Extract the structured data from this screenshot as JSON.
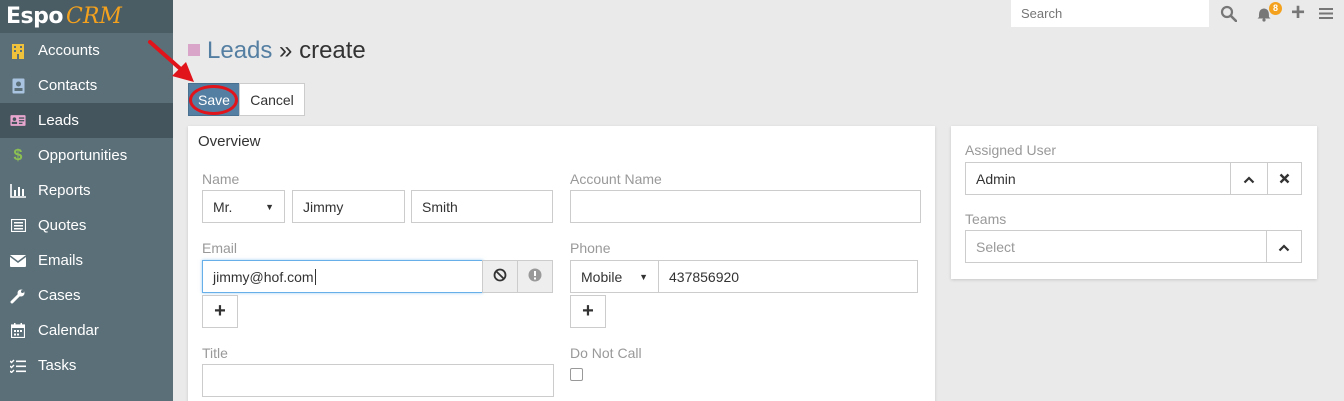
{
  "logo": {
    "espo": "Espo",
    "crm": "CRM"
  },
  "sidebar": {
    "items": [
      {
        "label": "Accounts",
        "icon": "building-icon"
      },
      {
        "label": "Contacts",
        "icon": "contact-card-icon"
      },
      {
        "label": "Leads",
        "icon": "id-card-icon"
      },
      {
        "label": "Opportunities",
        "icon": "dollar-icon"
      },
      {
        "label": "Reports",
        "icon": "bar-chart-icon"
      },
      {
        "label": "Quotes",
        "icon": "list-icon"
      },
      {
        "label": "Emails",
        "icon": "envelope-icon"
      },
      {
        "label": "Cases",
        "icon": "wrench-icon"
      },
      {
        "label": "Calendar",
        "icon": "calendar-icon"
      },
      {
        "label": "Tasks",
        "icon": "tasks-icon"
      }
    ]
  },
  "topbar": {
    "search_placeholder": "Search",
    "notifications_count": "8"
  },
  "header": {
    "crumb": "Leads",
    "separator": " » ",
    "action": "create"
  },
  "buttons": {
    "save": "Save",
    "cancel": "Cancel"
  },
  "overview": {
    "heading": "Overview",
    "name_label": "Name",
    "salutation": "Mr.",
    "first_name": "Jimmy",
    "last_name": "Smith",
    "account_name_label": "Account Name",
    "account_name": "",
    "email_label": "Email",
    "email": "jimmy@hof.com",
    "phone_label": "Phone",
    "phone_type": "Mobile",
    "phone": "437856920",
    "title_label": "Title",
    "title": "",
    "do_not_call_label": "Do Not Call"
  },
  "side": {
    "assigned_user_label": "Assigned User",
    "assigned_user": "Admin",
    "teams_label": "Teams",
    "teams_placeholder": "Select"
  },
  "colors": {
    "accent": "#557fa2",
    "sidebar": "#5b6f78",
    "highlight_red": "#e0141a",
    "badge": "#f4a21d"
  }
}
